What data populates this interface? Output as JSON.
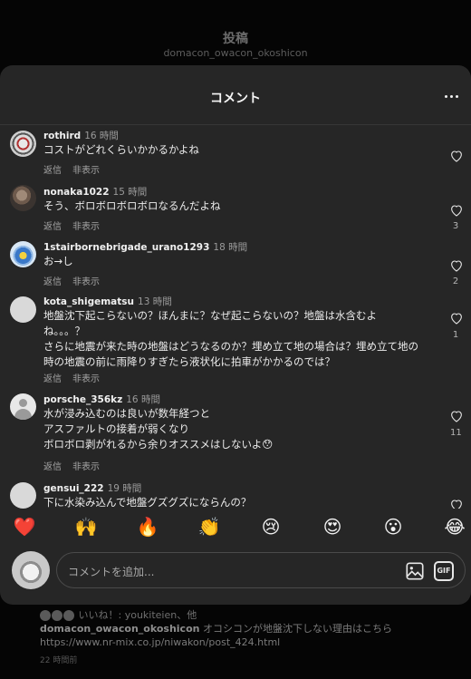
{
  "post_header": {
    "title": "投稿",
    "username": "domacon_owacon_okoshicon"
  },
  "comments_sheet": {
    "title": "コメント",
    "more_icon": "more-horizontal-icon",
    "reply_label": "返信",
    "hide_label": "非表示",
    "comments": [
      {
        "username": "rothird",
        "time": "16 時間",
        "text": [
          "コストがどれくらいかかるかよね"
        ],
        "likes": ""
      },
      {
        "username": "nonaka1022",
        "time": "15 時間",
        "text": [
          "そう、ボロボロボロボロなるんだよね"
        ],
        "likes": "3"
      },
      {
        "username": "1stairbornebrigade_urano1293",
        "time": "18 時間",
        "text": [
          "お→し"
        ],
        "likes": "2"
      },
      {
        "username": "kota_shigematsu",
        "time": "13 時間",
        "text": [
          "地盤沈下起こらないの？ほんまに？なぜ起こらないの？地盤は水含むよ",
          "ね。。。？",
          "さらに地震が来た時の地盤はどうなるのか？埋め立て地の場合は？埋め立て地の",
          "時の地震の前に雨降りすぎたら液状化に拍車がかかるのでは？"
        ],
        "likes": "1"
      },
      {
        "username": "porsche_356kz",
        "time": "16 時間",
        "text": [
          "水が浸み込むのは良いが数年経つと",
          "アスファルトの接着が弱くなり",
          "ボロボロ剥がれるから余りオススメはしないよ😯"
        ],
        "likes": "11"
      },
      {
        "username": "gensui_222",
        "time": "19 時間",
        "text": [
          "下に水染み込んで地盤グズグズにならんの？"
        ],
        "likes": ""
      }
    ]
  },
  "emoji_bar": [
    "❤️",
    "🙌",
    "🔥",
    "👏",
    "😢",
    "😍",
    "😮",
    "😂"
  ],
  "comment_input": {
    "placeholder": "コメントを追加...",
    "image_icon": "image-icon",
    "gif_label": "GIF"
  },
  "post_caption": {
    "likes_text": "いいね！: youkiteien、他",
    "author": "domacon_owacon_okoshicon",
    "caption_text": "オコシコンが地盤沈下しない理由はこちら",
    "link": "https://www.nr-mix.co.jp/niwakon/post_424.html",
    "time": "22 時間前"
  }
}
